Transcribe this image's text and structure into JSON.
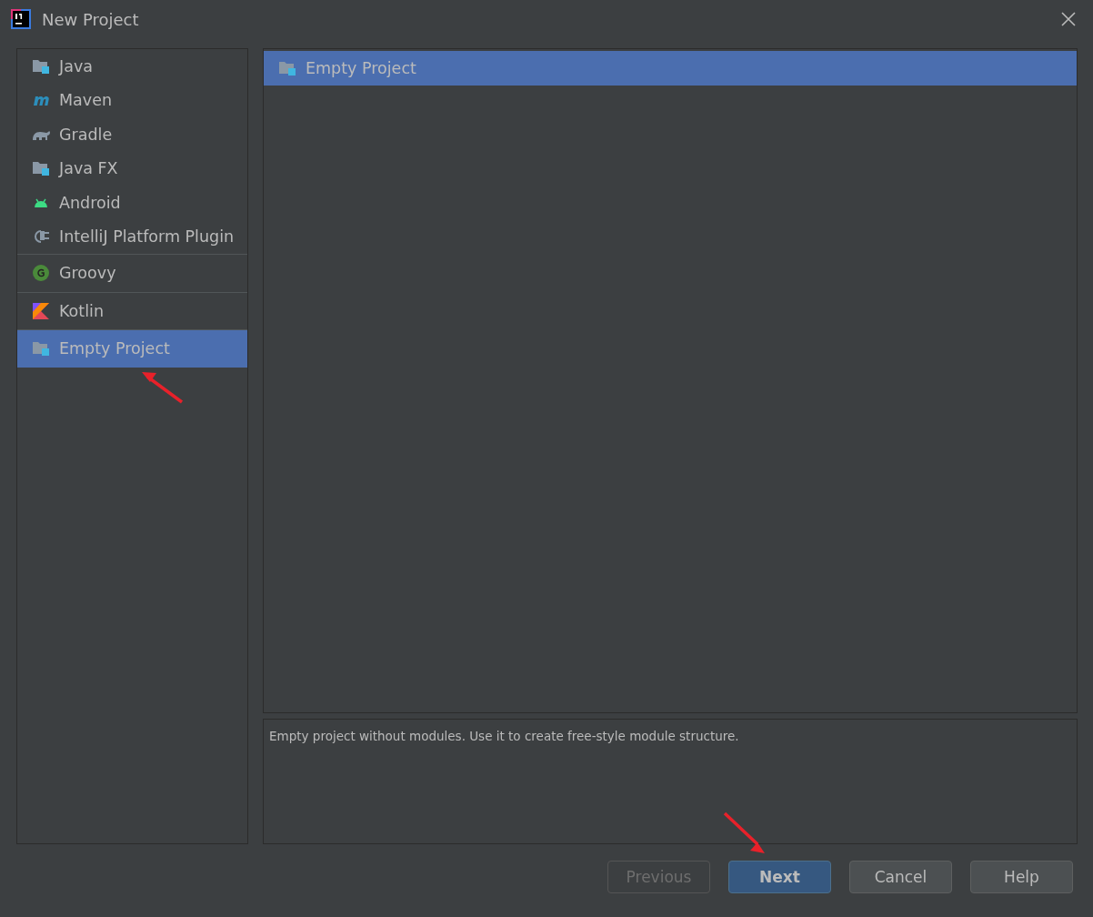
{
  "window": {
    "title": "New Project"
  },
  "sidebar": {
    "groups": [
      {
        "items": [
          {
            "label": "Java",
            "kind": "folder",
            "selected": false
          },
          {
            "label": "Maven",
            "kind": "maven",
            "selected": false
          },
          {
            "label": "Gradle",
            "kind": "gradle",
            "selected": false
          },
          {
            "label": "Java FX",
            "kind": "folder",
            "selected": false
          },
          {
            "label": "Android",
            "kind": "android",
            "selected": false
          },
          {
            "label": "IntelliJ Platform Plugin",
            "kind": "plugin",
            "selected": false
          }
        ]
      },
      {
        "items": [
          {
            "label": "Groovy",
            "kind": "groovy",
            "selected": false
          }
        ]
      },
      {
        "items": [
          {
            "label": "Kotlin",
            "kind": "kotlin",
            "selected": false
          }
        ]
      },
      {
        "items": [
          {
            "label": "Empty Project",
            "kind": "folder",
            "selected": true
          }
        ]
      }
    ]
  },
  "templates": [
    {
      "label": "Empty Project",
      "kind": "folder",
      "selected": true
    }
  ],
  "description": "Empty project without modules. Use it to create free-style module structure.",
  "buttons": [
    {
      "label": "Previous",
      "kind": "plain",
      "disabled": true
    },
    {
      "label": "Next",
      "kind": "default",
      "disabled": false
    },
    {
      "label": "Cancel",
      "kind": "plain",
      "disabled": false
    },
    {
      "label": "Help",
      "kind": "plain",
      "disabled": false
    }
  ],
  "annotations": [
    {
      "kind": "arrow"
    },
    {
      "kind": "arrow"
    }
  ]
}
